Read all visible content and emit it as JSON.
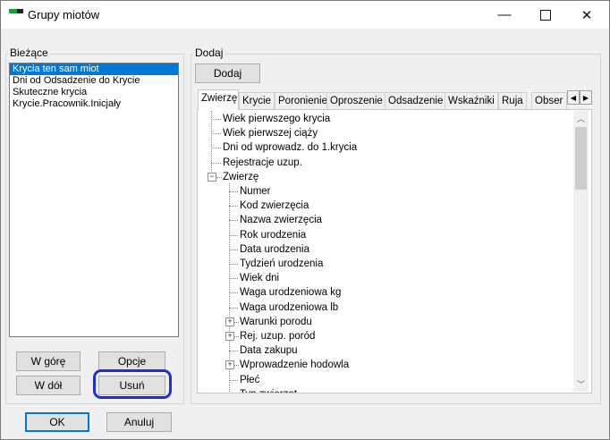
{
  "window": {
    "title": "Grupy miotów"
  },
  "left": {
    "group_label": "Bieżące",
    "items": [
      "Krycia ten sam miot",
      "Dni od Odsadzenie do Krycie",
      "Skuteczne krycia",
      "Krycie.Pracownik.Inicjały"
    ],
    "selected_index": 0,
    "buttons": {
      "up": "W górę",
      "options": "Opcje",
      "down": "W dół",
      "remove": "Usuń"
    }
  },
  "right": {
    "group_label": "Dodaj",
    "add_button": "Dodaj",
    "tabs": [
      "Zwierzę",
      "Krycie",
      "Poronienie",
      "Oproszenie",
      "Odsadzenie",
      "Wskaźniki",
      "Ruja",
      "Obser"
    ],
    "active_tab": 0,
    "tree": [
      {
        "label": "Wiek pierwszego krycia",
        "level": 0,
        "expander": ""
      },
      {
        "label": "Wiek pierwszej ciąży",
        "level": 0,
        "expander": ""
      },
      {
        "label": "Dni od wprowadz. do 1.krycia",
        "level": 0,
        "expander": ""
      },
      {
        "label": "Rejestracje uzup.",
        "level": 0,
        "expander": ""
      },
      {
        "label": "Zwierzę",
        "level": 0,
        "expander": "minus"
      },
      {
        "label": "Numer",
        "level": 1,
        "expander": ""
      },
      {
        "label": "Kod zwierzęcia",
        "level": 1,
        "expander": ""
      },
      {
        "label": "Nazwa zwierzęcia",
        "level": 1,
        "expander": ""
      },
      {
        "label": "Rok urodzenia",
        "level": 1,
        "expander": ""
      },
      {
        "label": "Data urodzenia",
        "level": 1,
        "expander": ""
      },
      {
        "label": "Tydzień urodzenia",
        "level": 1,
        "expander": ""
      },
      {
        "label": "Wiek dni",
        "level": 1,
        "expander": ""
      },
      {
        "label": "Waga urodzeniowa kg",
        "level": 1,
        "expander": ""
      },
      {
        "label": "Waga urodzeniowa lb",
        "level": 1,
        "expander": ""
      },
      {
        "label": "Warunki porodu",
        "level": 1,
        "expander": "plus"
      },
      {
        "label": "Rej. uzup. poród",
        "level": 1,
        "expander": "plus"
      },
      {
        "label": "Data zakupu",
        "level": 1,
        "expander": ""
      },
      {
        "label": "Wprowadzenie hodowla",
        "level": 1,
        "expander": "plus"
      },
      {
        "label": "Płeć",
        "level": 1,
        "expander": ""
      },
      {
        "label": "Typ zwierząt",
        "level": 1,
        "expander": ""
      }
    ]
  },
  "footer": {
    "ok": "OK",
    "cancel": "Anuluj"
  },
  "icons": {
    "app": "app-flag-icon",
    "minimize": "minimize-icon",
    "maximize": "maximize-icon",
    "close": "close-icon",
    "tab_left": "chevron-left-icon",
    "tab_right": "chevron-right-icon",
    "scroll_up": "chevron-up-icon",
    "scroll_down": "chevron-down-icon"
  },
  "colors": {
    "selection": "#0078d7",
    "highlight_ring": "#1a2fd6",
    "accent_green": "#1f9b3a"
  }
}
